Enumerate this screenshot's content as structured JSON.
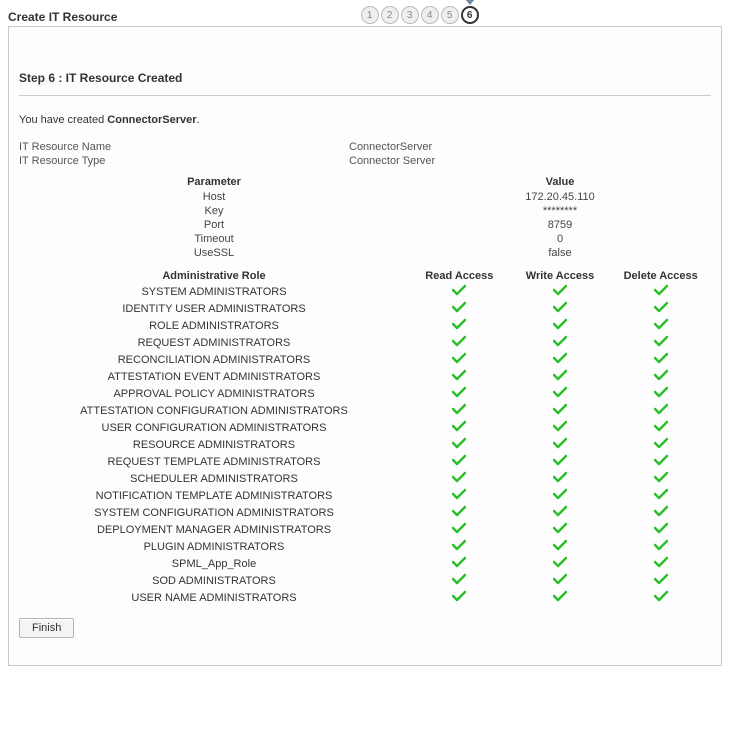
{
  "header": {
    "title": "Create IT Resource"
  },
  "stepper": {
    "steps": [
      "1",
      "2",
      "3",
      "4",
      "5",
      "6"
    ],
    "current_index": 5
  },
  "step_title": "Step 6 : IT Resource Created",
  "created": {
    "prefix": "You have created ",
    "name": "ConnectorServer",
    "suffix": "."
  },
  "info": [
    {
      "label": "IT Resource Name",
      "value": "ConnectorServer"
    },
    {
      "label": "IT Resource Type",
      "value": "Connector Server"
    }
  ],
  "parameters": {
    "headers": {
      "name": "Parameter",
      "value": "Value"
    },
    "rows": [
      {
        "name": "Host",
        "value": "172.20.45.110"
      },
      {
        "name": "Key",
        "value": "********"
      },
      {
        "name": "Port",
        "value": "8759"
      },
      {
        "name": "Timeout",
        "value": "0"
      },
      {
        "name": "UseSSL",
        "value": "false"
      }
    ]
  },
  "roles": {
    "headers": {
      "name": "Administrative Role",
      "read": "Read Access",
      "write": "Write Access",
      "delete": "Delete Access"
    },
    "rows": [
      {
        "name": "SYSTEM ADMINISTRATORS",
        "read": true,
        "write": true,
        "delete": true
      },
      {
        "name": "IDENTITY USER ADMINISTRATORS",
        "read": true,
        "write": true,
        "delete": true
      },
      {
        "name": "ROLE ADMINISTRATORS",
        "read": true,
        "write": true,
        "delete": true
      },
      {
        "name": "REQUEST ADMINISTRATORS",
        "read": true,
        "write": true,
        "delete": true
      },
      {
        "name": "RECONCILIATION ADMINISTRATORS",
        "read": true,
        "write": true,
        "delete": true
      },
      {
        "name": "ATTESTATION EVENT ADMINISTRATORS",
        "read": true,
        "write": true,
        "delete": true
      },
      {
        "name": "APPROVAL POLICY ADMINISTRATORS",
        "read": true,
        "write": true,
        "delete": true
      },
      {
        "name": "ATTESTATION CONFIGURATION ADMINISTRATORS",
        "read": true,
        "write": true,
        "delete": true
      },
      {
        "name": "USER CONFIGURATION ADMINISTRATORS",
        "read": true,
        "write": true,
        "delete": true
      },
      {
        "name": "RESOURCE ADMINISTRATORS",
        "read": true,
        "write": true,
        "delete": true
      },
      {
        "name": "REQUEST TEMPLATE ADMINISTRATORS",
        "read": true,
        "write": true,
        "delete": true
      },
      {
        "name": "SCHEDULER ADMINISTRATORS",
        "read": true,
        "write": true,
        "delete": true
      },
      {
        "name": "NOTIFICATION TEMPLATE ADMINISTRATORS",
        "read": true,
        "write": true,
        "delete": true
      },
      {
        "name": "SYSTEM CONFIGURATION ADMINISTRATORS",
        "read": true,
        "write": true,
        "delete": true
      },
      {
        "name": "DEPLOYMENT MANAGER ADMINISTRATORS",
        "read": true,
        "write": true,
        "delete": true
      },
      {
        "name": "PLUGIN ADMINISTRATORS",
        "read": true,
        "write": true,
        "delete": true
      },
      {
        "name": "SPML_App_Role",
        "read": true,
        "write": true,
        "delete": true
      },
      {
        "name": "SOD ADMINISTRATORS",
        "read": true,
        "write": true,
        "delete": true
      },
      {
        "name": "USER NAME ADMINISTRATORS",
        "read": true,
        "write": true,
        "delete": true
      }
    ]
  },
  "actions": {
    "finish_label": "Finish"
  }
}
